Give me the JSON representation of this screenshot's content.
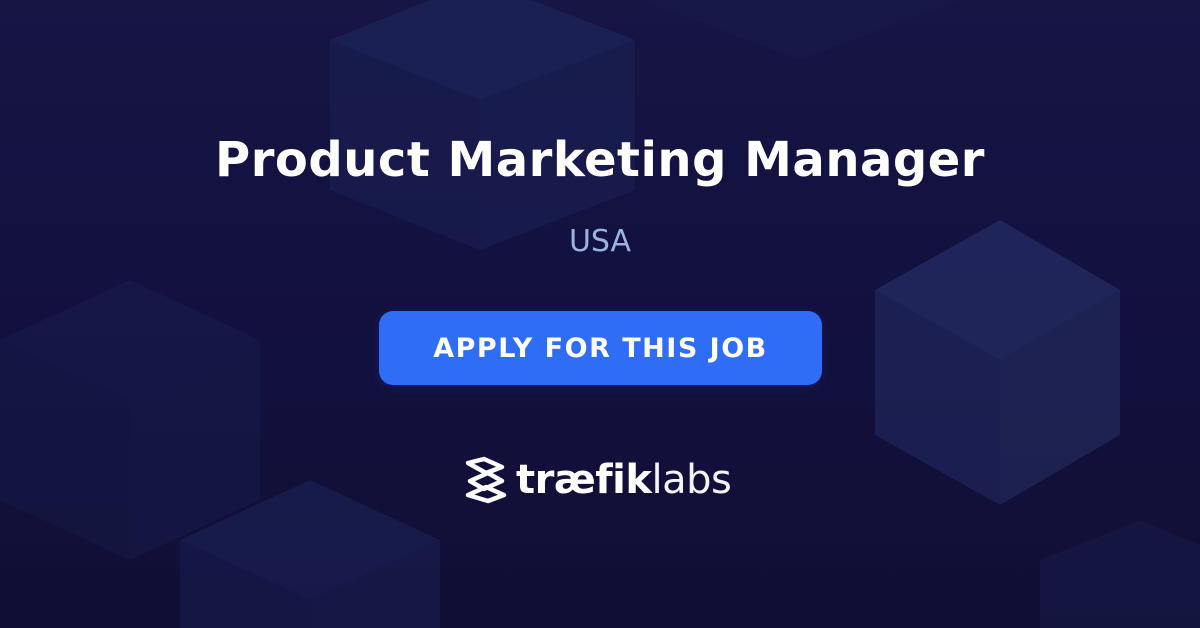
{
  "posting": {
    "title": "Product Marketing Manager",
    "location": "USA",
    "apply_label": "APPLY FOR THIS JOB"
  },
  "brand": {
    "wordmark_primary": "træfik",
    "wordmark_secondary": "labs",
    "logo_icon": "traefik-logo-icon"
  },
  "colors": {
    "background": "#131140",
    "title": "#ffffff",
    "location": "#9cb2e0",
    "button": "#2f6df6",
    "button_text": "#ffffff"
  }
}
